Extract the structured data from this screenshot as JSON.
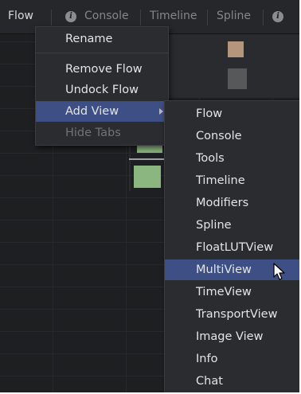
{
  "tabs": [
    {
      "label": "Flow"
    },
    {
      "label": "Console"
    },
    {
      "label": "Timeline"
    },
    {
      "label": "Spline"
    }
  ],
  "context_menu": {
    "items": [
      {
        "label": "Rename"
      },
      {
        "label": "Remove Flow"
      },
      {
        "label": "Undock Flow"
      },
      {
        "label": "Add View"
      },
      {
        "label": "Hide Tabs"
      }
    ]
  },
  "add_view_submenu": {
    "items": [
      {
        "label": "Flow"
      },
      {
        "label": "Console"
      },
      {
        "label": "Tools"
      },
      {
        "label": "Timeline"
      },
      {
        "label": "Modifiers"
      },
      {
        "label": "Spline"
      },
      {
        "label": "FloatLUTView"
      },
      {
        "label": "MultiView"
      },
      {
        "label": "TimeView"
      },
      {
        "label": "TransportView"
      },
      {
        "label": "Image View"
      },
      {
        "label": "Info"
      },
      {
        "label": "Chat"
      }
    ]
  },
  "colors": {
    "highlight": "#3d4f84",
    "menu_bg": "#2a2c2f",
    "panel_bg": "#1f2022"
  }
}
